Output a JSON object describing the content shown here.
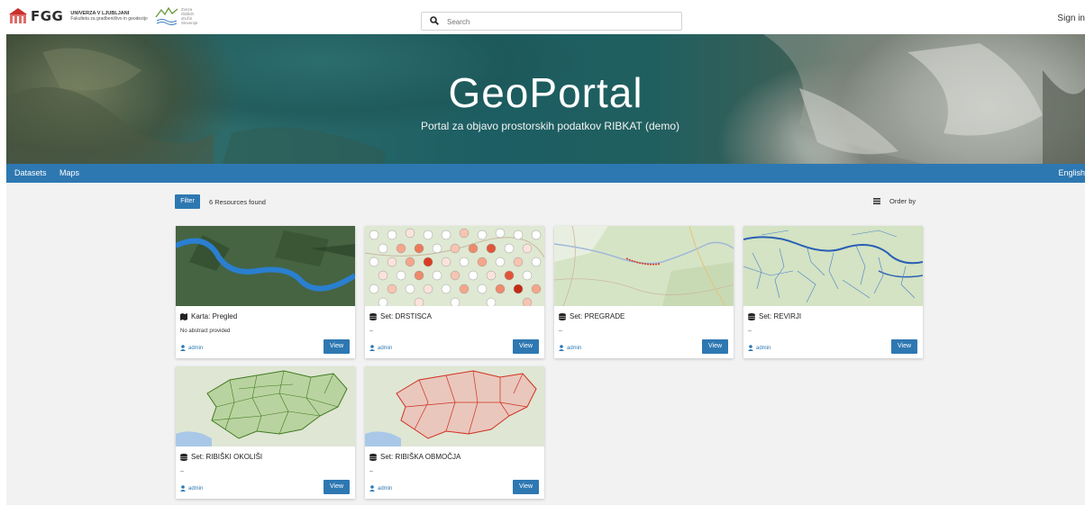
{
  "header": {
    "logo_text": "FGG",
    "university_name": "UNIVERZA V LJUBLJANI",
    "faculty_name": "Fakulteta za gradbeništvo in geodezijo",
    "partner_logo_lines": [
      "Zveza",
      "ribiških",
      "družin",
      "Slovenije"
    ],
    "search_placeholder": "Search",
    "signin_label": "Sign in"
  },
  "hero": {
    "title": "GeoPortal",
    "subtitle": "Portal za objavo prostorskih podatkov RIBKAT (demo)"
  },
  "nav": {
    "datasets": "Datasets",
    "maps": "Maps",
    "language": "English"
  },
  "toolbar": {
    "filter_label": "Filter",
    "resources_found": "6 Resources found",
    "order_by_label": "Order by"
  },
  "cards": [
    {
      "type_icon": "map-icon",
      "title": "Karta: Pregled",
      "abstract": "No abstract provided",
      "owner": "admin",
      "view_label": "View"
    },
    {
      "type_icon": "database-icon",
      "title": "Set: DRSTISCA",
      "abstract": "--",
      "owner": "admin",
      "view_label": "View"
    },
    {
      "type_icon": "database-icon",
      "title": "Set: PREGRADE",
      "abstract": "--",
      "owner": "admin",
      "view_label": "View"
    },
    {
      "type_icon": "database-icon",
      "title": "Set: REVIRJI",
      "abstract": "--",
      "owner": "admin",
      "view_label": "View"
    },
    {
      "type_icon": "database-icon",
      "title": "Set: RIBIŠKI OKOLIŠI",
      "abstract": "--",
      "owner": "admin",
      "view_label": "View"
    },
    {
      "type_icon": "database-icon",
      "title": "Set: RIBIŠKA OBMOČJA",
      "abstract": "--",
      "owner": "admin",
      "view_label": "View"
    }
  ],
  "colors": {
    "primary": "#2e78b2",
    "background": "#f2f2f2"
  }
}
